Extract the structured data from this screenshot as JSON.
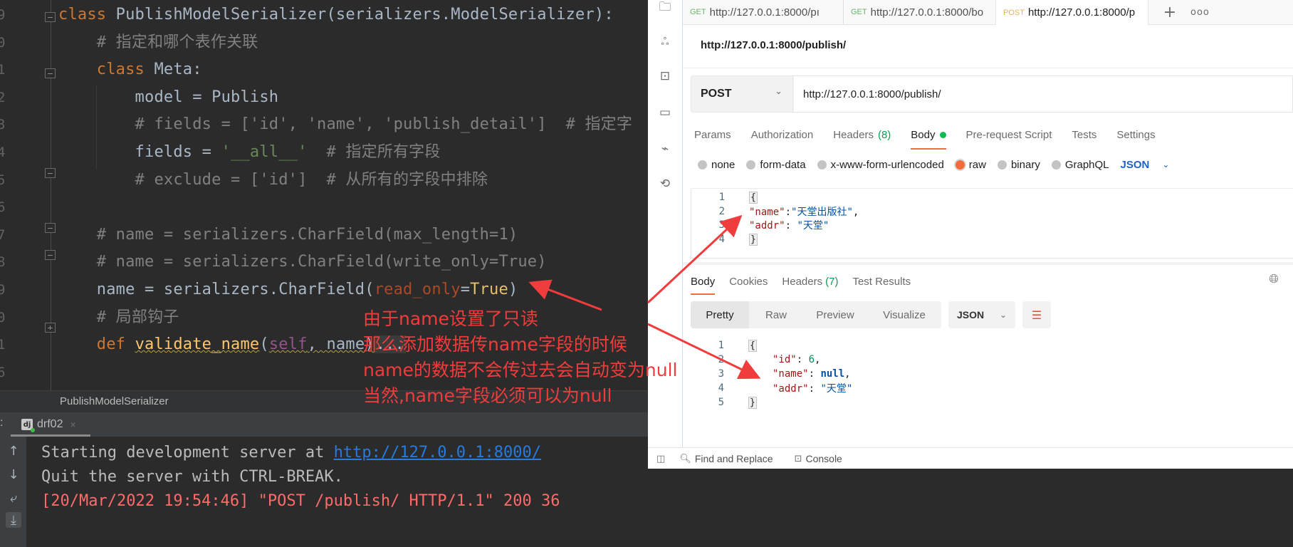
{
  "editor": {
    "line_numbers": [
      "9",
      "0",
      "1",
      "2",
      "3",
      "4",
      "5",
      "6",
      "7",
      "8",
      "9",
      "0",
      "1",
      "6"
    ],
    "lines": [
      {
        "parts": [
          {
            "t": "class ",
            "c": "kw"
          },
          {
            "t": "PublishModelSerializer(serializers.ModelSerializer):",
            "c": "cls"
          }
        ]
      },
      {
        "parts": [
          {
            "t": "    # 指定和哪个表作关联",
            "c": "cmt"
          }
        ]
      },
      {
        "parts": [
          {
            "t": "    class ",
            "c": "kw"
          },
          {
            "t": "Meta:",
            "c": "cls"
          }
        ]
      },
      {
        "parts": [
          {
            "t": "        model = Publish",
            "c": "cls"
          }
        ]
      },
      {
        "parts": [
          {
            "t": "        # fields = ['id', 'name', 'publish_detail']  # 指定字",
            "c": "cmt"
          }
        ]
      },
      {
        "parts": [
          {
            "t": "        fields = ",
            "c": "cls"
          },
          {
            "t": "'__all__'",
            "c": "str"
          },
          {
            "t": "  # 指定所有字段",
            "c": "cmt"
          }
        ]
      },
      {
        "parts": [
          {
            "t": "        # exclude = ['id']  # 从所有的字段中排除",
            "c": "cmt"
          }
        ]
      },
      {
        "parts": [
          {
            "t": "",
            "c": "cls"
          }
        ]
      },
      {
        "parts": [
          {
            "t": "    # name = serializers.CharField(max_length=1)",
            "c": "cmt"
          }
        ]
      },
      {
        "parts": [
          {
            "t": "    # name = serializers.CharField(write_only=True)",
            "c": "cmt"
          }
        ]
      },
      {
        "parts": [
          {
            "t": "    name = serializers.CharField(",
            "c": "cls"
          },
          {
            "t": "read_only",
            "c": "param"
          },
          {
            "t": "=",
            "c": "cls"
          },
          {
            "t": "True",
            "c": "tr"
          },
          {
            "t": ")",
            "c": "cls"
          }
        ]
      },
      {
        "parts": [
          {
            "t": "    # 局部钩子",
            "c": "cmt"
          }
        ]
      },
      {
        "parts": [
          {
            "t": "    def ",
            "c": "kw"
          },
          {
            "t": "validate_name",
            "c": "fn"
          },
          {
            "t": "(",
            "c": "cls"
          },
          {
            "t": "self",
            "c": "self"
          },
          {
            "t": ", name)",
            "c": "cls"
          },
          {
            "t": "...",
            "c": "fold-ellipsis"
          }
        ]
      },
      {
        "parts": [
          {
            "t": "",
            "c": "cls"
          }
        ]
      }
    ],
    "breadcrumb": "PublishModelSerializer"
  },
  "run_panel": {
    "colon": ":",
    "tab_icon": "dj",
    "tab_label": "drf02",
    "close": "×",
    "lines": [
      {
        "text": "Starting development server at ",
        "link": "http://127.0.0.1:8000/"
      },
      {
        "text": "Quit the server with CTRL-BREAK."
      },
      {
        "text": "[20/Mar/2022 19:54:46] \"POST /publish/ HTTP/1.1\" 200 36",
        "error": true
      }
    ],
    "side_icons": [
      "arrow-up",
      "arrow-down",
      "soft-wrap",
      "scroll-to-end"
    ]
  },
  "annotation": {
    "lines": [
      "由于name设置了只读",
      "那么添加数据传name字段的时候",
      "name的数据不会传过去会自动变为null",
      "当然,name字段必须可以为null"
    ],
    "color": "#f03c3c"
  },
  "postman": {
    "tabs": [
      {
        "method": "GET",
        "url": "http://127.0.0.1:8000/pı",
        "unsaved": true,
        "active": false
      },
      {
        "method": "GET",
        "url": "http://127.0.0.1:8000/bo",
        "unsaved": true,
        "active": false
      },
      {
        "method": "POST",
        "url": "http://127.0.0.1:8000/p",
        "unsaved": true,
        "active": true
      }
    ],
    "new_tab": "+",
    "more": "ooo",
    "request_title": "http://127.0.0.1:8000/publish/",
    "method": "POST",
    "url": "http://127.0.0.1:8000/publish/",
    "request_tabs": {
      "params": "Params",
      "authorization": "Authorization",
      "headers": "Headers",
      "headers_count": "(8)",
      "body": "Body",
      "pre_request": "Pre-request Script",
      "tests": "Tests",
      "settings": "Settings"
    },
    "body_types": [
      "none",
      "form-data",
      "x-www-form-urlencoded",
      "raw",
      "binary",
      "GraphQL"
    ],
    "body_type_selected": "raw",
    "body_format": "JSON",
    "request_body": [
      {
        "num": "1",
        "brace": "{"
      },
      {
        "num": "2",
        "key": "\"name\"",
        "sep": ":",
        "val": "\"天堂出版社\"",
        "trail": ","
      },
      {
        "num": "3",
        "key": "\"addr\"",
        "sep": ": ",
        "val": "\"天堂\"",
        "trail": ""
      },
      {
        "num": "4",
        "brace": "}"
      }
    ],
    "response_tabs": {
      "body": "Body",
      "cookies": "Cookies",
      "headers": "Headers",
      "headers_count": "(7)",
      "test_results": "Test Results"
    },
    "view_modes": [
      "Pretty",
      "Raw",
      "Preview",
      "Visualize"
    ],
    "view_mode_selected": "Pretty",
    "response_format": "JSON",
    "response_body": [
      {
        "num": "1",
        "brace": "{"
      },
      {
        "num": "2",
        "key": "\"id\"",
        "sep": ": ",
        "num_val": "6",
        "trail": ","
      },
      {
        "num": "3",
        "key": "\"name\"",
        "sep": ": ",
        "null_val": "null",
        "trail": ","
      },
      {
        "num": "4",
        "key": "\"addr\"",
        "sep": ": ",
        "val": "\"天堂\"",
        "trail": ""
      },
      {
        "num": "5",
        "brace": "}"
      }
    ],
    "footer": {
      "find_replace": "Find and Replace",
      "console": "Console"
    },
    "accent_color": "#f26b3a",
    "success_color": "#0cbb52"
  }
}
